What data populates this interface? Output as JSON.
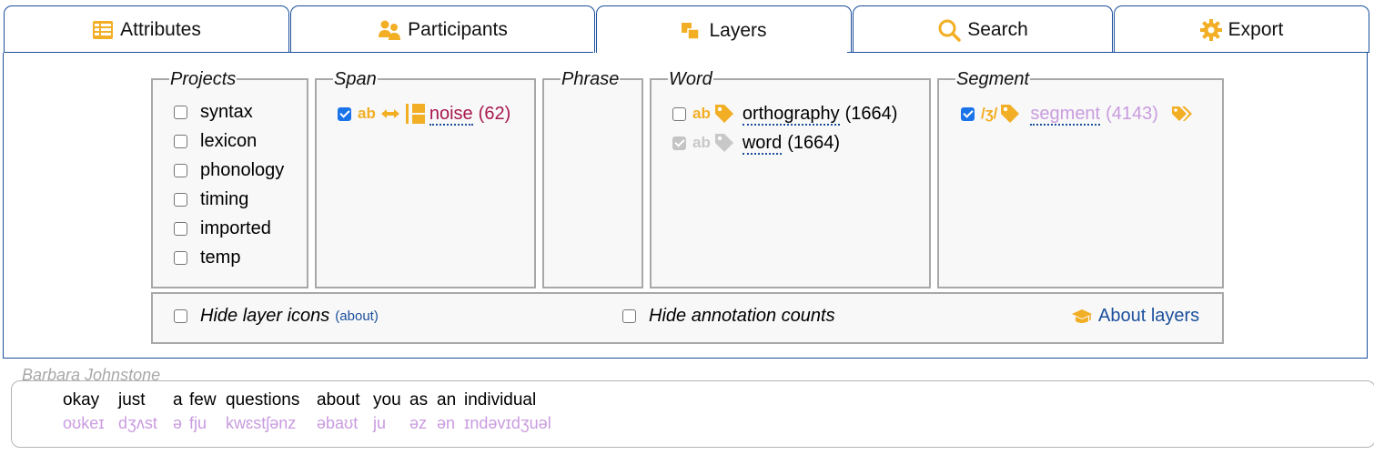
{
  "tabs": [
    {
      "label": "Attributes",
      "icon": "table-icon"
    },
    {
      "label": "Participants",
      "icon": "people-icon"
    },
    {
      "label": "Layers",
      "icon": "layers-icon",
      "active": true
    },
    {
      "label": "Search",
      "icon": "magnifier-icon"
    },
    {
      "label": "Export",
      "icon": "gear-icon"
    }
  ],
  "projects": {
    "legend": "Projects",
    "items": [
      "syntax",
      "lexicon",
      "phonology",
      "timing",
      "imported",
      "temp"
    ]
  },
  "span": {
    "legend": "Span",
    "layer": {
      "type_glyph": "ab",
      "name": "noise",
      "count": "(62)",
      "checked": true
    }
  },
  "phrase": {
    "legend": "Phrase"
  },
  "word": {
    "legend": "Word",
    "layers": [
      {
        "type_glyph": "ab",
        "name": "orthography",
        "count": "(1664)",
        "checked": false
      },
      {
        "type_glyph": "ab",
        "name": "word",
        "count": "(1664)",
        "checked": true,
        "disabled": true
      }
    ]
  },
  "segment": {
    "legend": "Segment",
    "layer": {
      "type_glyph": "/ʒ/",
      "name": "segment",
      "count": "(4143)",
      "checked": true
    }
  },
  "options": {
    "hide_icons_label": "Hide layer icons",
    "about_link": "(about)",
    "hide_counts_label": "Hide annotation counts",
    "about_layers": "About layers"
  },
  "transcript": {
    "speaker": "Barbara Johnstone",
    "words": [
      {
        "w": "okay",
        "ph": "oʊkeɪ"
      },
      {
        "w": "just",
        "ph": "dʒʌst"
      },
      {
        "w": "a",
        "ph": "ə"
      },
      {
        "w": "few",
        "ph": "fju"
      },
      {
        "w": "questions",
        "ph": "kwɛstʃənz"
      },
      {
        "w": "about",
        "ph": "əbaʊt"
      },
      {
        "w": "you",
        "ph": "ju"
      },
      {
        "w": "as",
        "ph": "əz"
      },
      {
        "w": "an",
        "ph": "ən"
      },
      {
        "w": "individual",
        "ph": "ɪndəvɪdʒuəl"
      }
    ]
  },
  "colors": {
    "accent": "#1b4f9c",
    "icon": "#f2ae24",
    "noise": "#a8174e",
    "segment": "#c99be0",
    "checkbox": "#1a73e8"
  }
}
